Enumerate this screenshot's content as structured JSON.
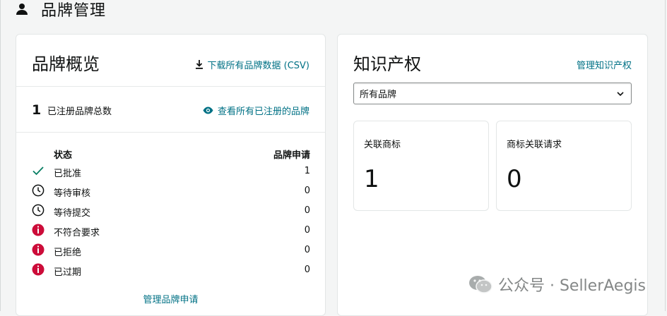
{
  "page": {
    "title": "品牌管理",
    "title_icon": "person-icon"
  },
  "overview": {
    "title": "品牌概览",
    "download_link": "下载所有品牌数据 (CSV)",
    "total_count": "1",
    "total_label": "已注册品牌总数",
    "view_all_link": "查看所有已注册的品牌",
    "table_header": {
      "status": "状态",
      "applications": "品牌申请"
    },
    "rows": [
      {
        "label": "已批准",
        "count": "1",
        "icon": "check-icon"
      },
      {
        "label": "等待审核",
        "count": "0",
        "icon": "clock-icon"
      },
      {
        "label": "等待提交",
        "count": "0",
        "icon": "clock-icon"
      },
      {
        "label": "不符合要求",
        "count": "0",
        "icon": "alert-icon"
      },
      {
        "label": "已拒绝",
        "count": "0",
        "icon": "alert-icon"
      },
      {
        "label": "已过期",
        "count": "0",
        "icon": "alert-icon"
      }
    ],
    "manage_link": "管理品牌申请"
  },
  "ip": {
    "title": "知识产权",
    "manage_link": "管理知识产权",
    "select_value": "所有品牌",
    "tiles": [
      {
        "label": "关联商标",
        "value": "1"
      },
      {
        "label": "商标关联请求",
        "value": "0"
      }
    ]
  },
  "watermark": {
    "text": "公众号 · SellerAegis"
  },
  "colors": {
    "link": "#007185",
    "success": "#067d62",
    "alert": "#cc0c39",
    "text": "#0f1111"
  }
}
